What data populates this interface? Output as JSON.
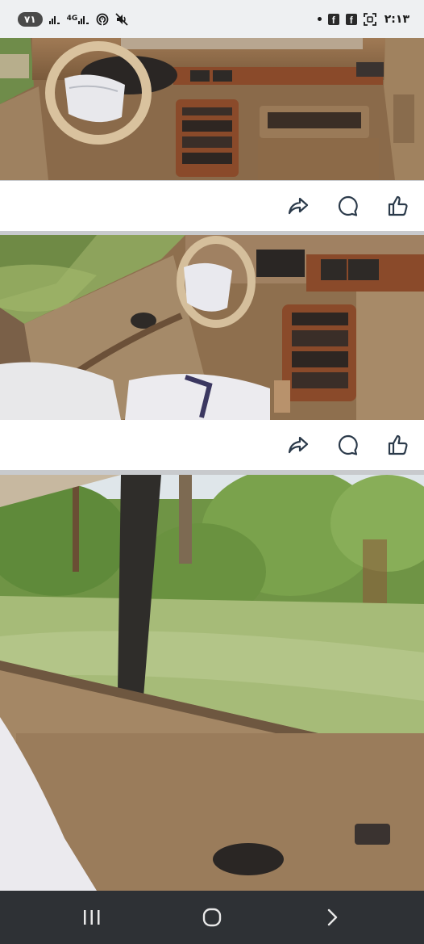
{
  "status_bar": {
    "badge": "٧١",
    "network_label": "4G",
    "time": "٢:١٣",
    "icons": [
      "signal-icon",
      "4g-signal-icon",
      "hotspot-icon",
      "mute-icon",
      "notification-dot-icon",
      "facebook-icon",
      "facebook-icon",
      "screenshot-icon"
    ]
  },
  "posts": [
    {
      "photo": "car-dashboard-photo",
      "actions": [
        "share-icon",
        "comment-icon",
        "like-icon"
      ]
    },
    {
      "photo": "car-interior-door-photo",
      "actions": [
        "share-icon",
        "comment-icon",
        "like-icon"
      ]
    },
    {
      "photo": "car-window-view-photo",
      "actions": []
    }
  ],
  "nav": {
    "buttons": [
      "recent-apps",
      "home",
      "back"
    ]
  },
  "colors": {
    "status_bg": "#eef0f2",
    "nav_bg": "#2e3135",
    "separator": "#c8cacd",
    "icon": "#2b3a4a"
  }
}
